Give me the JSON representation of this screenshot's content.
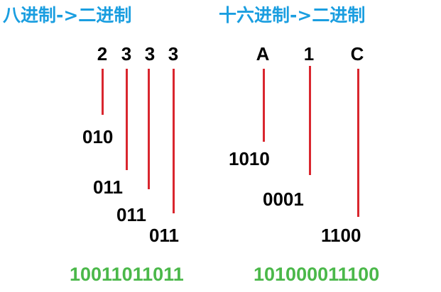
{
  "colors": {
    "title": "#1a9ee0",
    "line": "#d9262e",
    "result": "#4bb84a",
    "text": "#000000"
  },
  "octal": {
    "title": "八进制->二进制",
    "digits": [
      "2",
      "3",
      "3",
      "3"
    ],
    "groups": [
      "010",
      "011",
      "011",
      "011"
    ],
    "result": "10011011011"
  },
  "hex": {
    "title": "十六进制->二进制",
    "digits": [
      "A",
      "1",
      "C"
    ],
    "groups": [
      "1010",
      "0001",
      "1100"
    ],
    "result": "101000011100"
  }
}
